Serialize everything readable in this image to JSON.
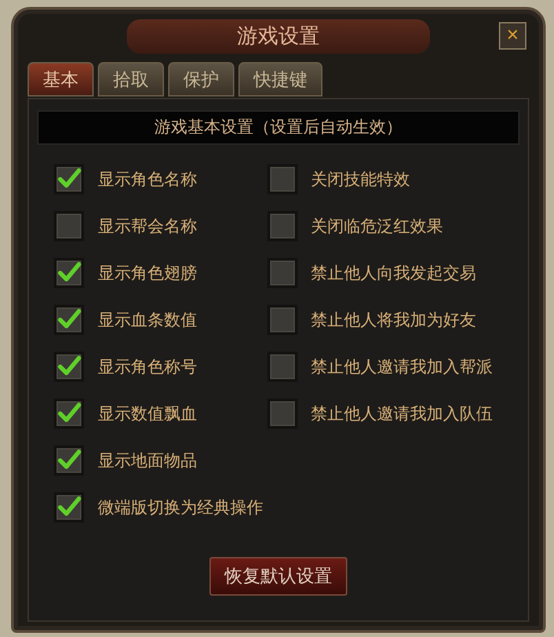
{
  "window": {
    "title": "游戏设置",
    "close": "×"
  },
  "tabs": [
    {
      "label": "基本",
      "selected": true
    },
    {
      "label": "拾取",
      "selected": false
    },
    {
      "label": "保护",
      "selected": false
    },
    {
      "label": "快捷键",
      "selected": false
    }
  ],
  "section_header": "游戏基本设置（设置后自动生效）",
  "columns": [
    [
      {
        "label": "显示角色名称",
        "checked": true
      },
      {
        "label": "显示帮会名称",
        "checked": false
      },
      {
        "label": "显示角色翅膀",
        "checked": true
      },
      {
        "label": "显示血条数值",
        "checked": true
      },
      {
        "label": "显示角色称号",
        "checked": true
      },
      {
        "label": "显示数值飘血",
        "checked": true
      },
      {
        "label": "显示地面物品",
        "checked": true
      },
      {
        "label": "微端版切换为经典操作",
        "checked": true
      }
    ],
    [
      {
        "label": "关闭技能特效",
        "checked": false
      },
      {
        "label": "关闭临危泛红效果",
        "checked": false
      },
      {
        "label": "禁止他人向我发起交易",
        "checked": false
      },
      {
        "label": "禁止他人将我加为好友",
        "checked": false
      },
      {
        "label": "禁止他人邀请我加入帮派",
        "checked": false
      },
      {
        "label": "禁止他人邀请我加入队伍",
        "checked": false
      }
    ]
  ],
  "buttons": [
    "恢复默认设置"
  ]
}
